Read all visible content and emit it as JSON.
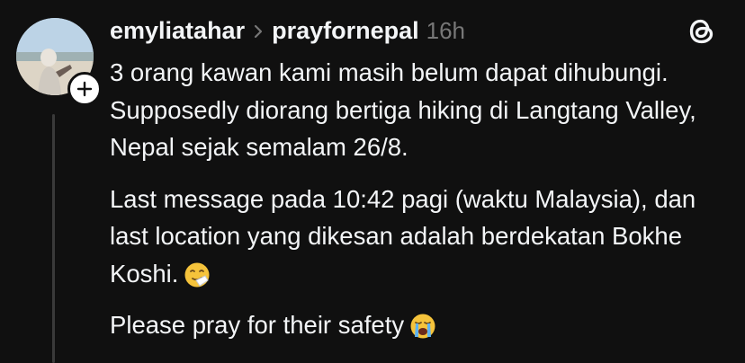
{
  "post": {
    "author": "emyliatahar",
    "target": "prayfornepal",
    "time": "16h",
    "paragraphs": [
      "3 orang kawan kami masih belum dapat dihubungi. Supposedly diorang bertiga hiking di Langtang Valley, Nepal sejak semalam 26/8.",
      "Last message pada 10:42 pagi (waktu Malaysia), dan last location yang dikesan adalah berdekatan Bokhe Koshi.",
      "Please pray for their safety"
    ]
  },
  "icons": {
    "separator": "chevron-right-icon",
    "app": "threads-logo-icon",
    "follow": "plus-icon",
    "emoji_1": "sneezing-face-emoji",
    "emoji_2": "loudly-crying-face-emoji"
  },
  "colors": {
    "background": "#101010",
    "text": "#f3f5f7",
    "muted": "#777777",
    "thread_line": "#3a3a3a"
  }
}
